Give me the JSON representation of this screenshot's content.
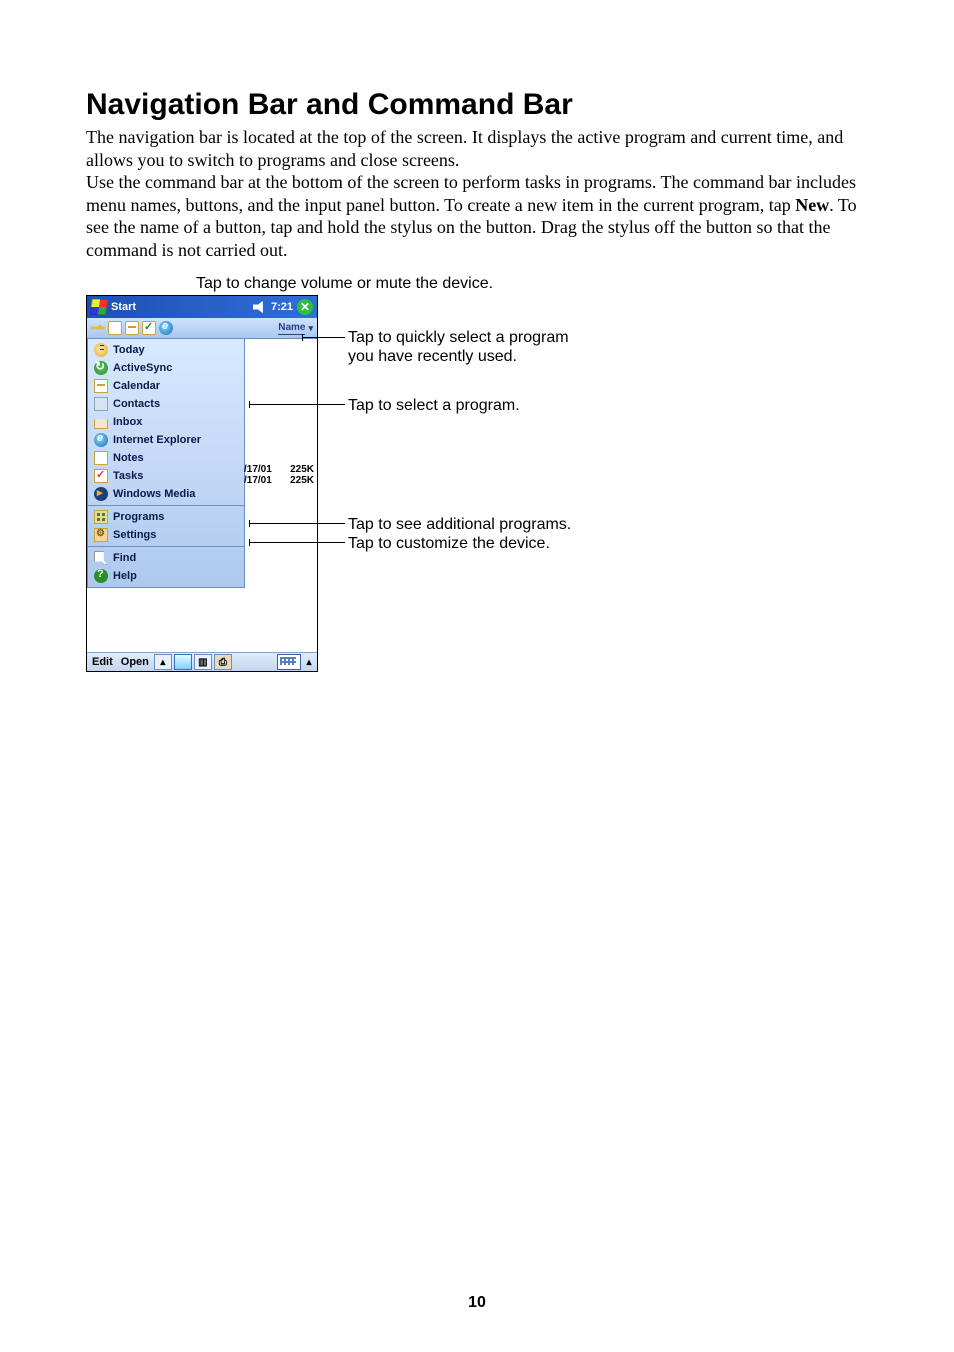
{
  "heading": "Navigation Bar and Command Bar",
  "para1": "The navigation bar is located at the top of the screen. It displays the active program and current time, and allows you to switch to programs and close screens.",
  "para2_pre": "Use the command bar at the bottom of the screen to perform tasks in programs. The command bar includes menu names, buttons, and the input panel button. To create a new item in the current program, tap ",
  "para2_bold": "New",
  "para2_post": ". To see the name of a button, tap and hold the stylus on the button. Drag the stylus off the button so that the command is not carried out.",
  "captions": {
    "top": "Tap to change volume or mute the device.",
    "recent1": "Tap to quickly select a program",
    "recent2": "you have recently used.",
    "select": "Tap to select a program.",
    "programs": "Tap to see additional programs.",
    "settings": "Tap to customize the device."
  },
  "device": {
    "titlebar": {
      "start": "Start",
      "time": "7:21"
    },
    "recent": {
      "name_col": "Name"
    },
    "menu": {
      "g1": [
        "Today",
        "ActiveSync",
        "Calendar",
        "Contacts",
        "Inbox",
        "Internet Explorer",
        "Notes",
        "Tasks",
        "Windows Media"
      ],
      "g2": [
        "Programs",
        "Settings"
      ],
      "g3": [
        "Find",
        "Help"
      ]
    },
    "content_rows": [
      {
        "date": "/17/01",
        "size": "225K"
      },
      {
        "date": "/17/01",
        "size": "225K"
      }
    ],
    "cmdbar": {
      "edit": "Edit",
      "open": "Open",
      "up": "▴",
      "up2": "▴"
    }
  },
  "page_number": "10"
}
